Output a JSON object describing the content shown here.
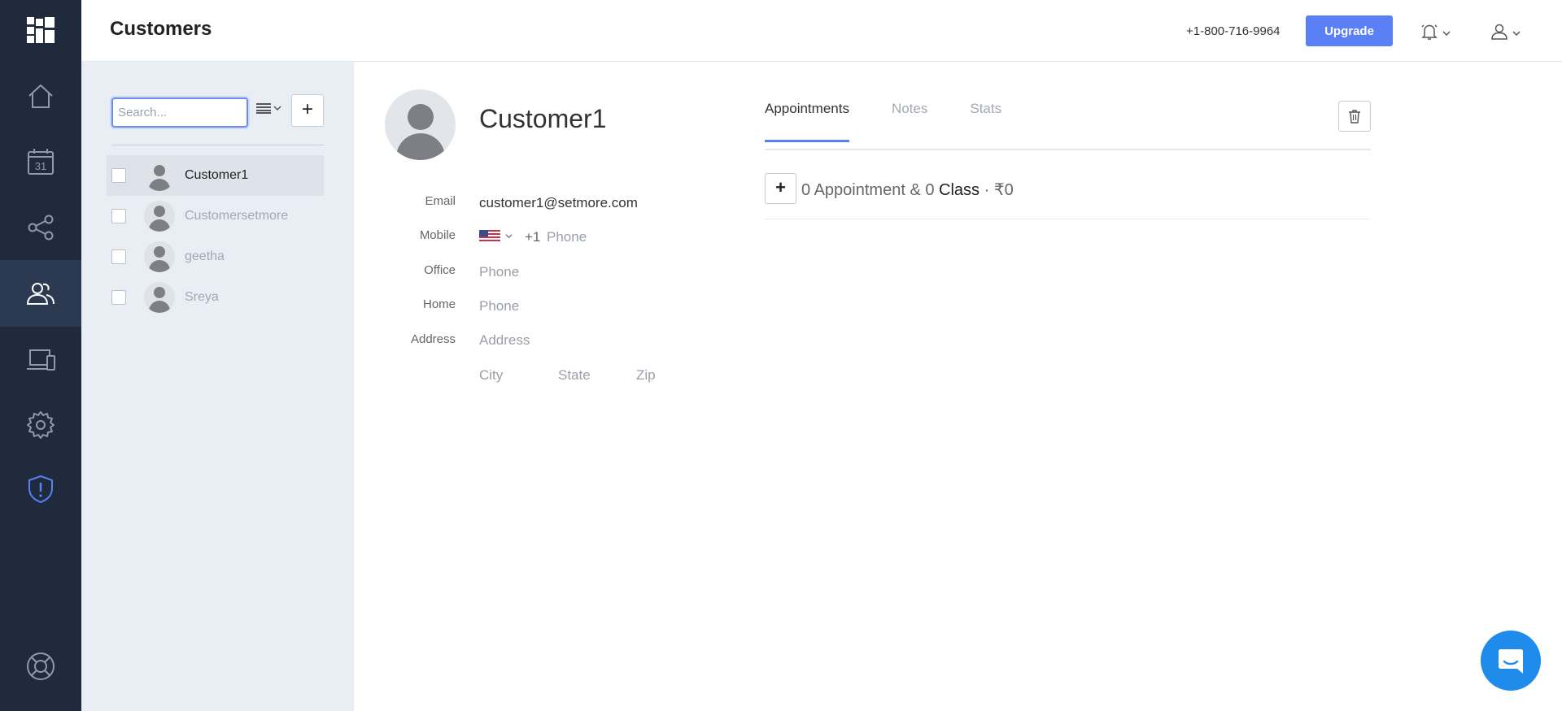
{
  "header": {
    "title": "Customers",
    "phone": "+1-800-716-9964",
    "upgrade_label": "Upgrade"
  },
  "rail": {
    "items": [
      "home-icon",
      "calendar-icon",
      "share-icon",
      "customers-icon",
      "devices-icon",
      "settings-icon",
      "shield-alert-icon",
      "help-icon"
    ],
    "active": "customers-icon",
    "calendar_day": "31"
  },
  "list": {
    "search_placeholder": "Search...",
    "add_label": "+",
    "customers": [
      {
        "name": "Customer1",
        "selected": true
      },
      {
        "name": "Customersetmore",
        "selected": false
      },
      {
        "name": "geetha",
        "selected": false
      },
      {
        "name": "Sreya",
        "selected": false
      }
    ]
  },
  "detail": {
    "name": "Customer1",
    "labels": {
      "email": "Email",
      "mobile": "Mobile",
      "office": "Office",
      "home": "Home",
      "address": "Address"
    },
    "email": "customer1@setmore.com",
    "mobile_code": "+1",
    "mobile_placeholder": "Phone",
    "office_placeholder": "Phone",
    "home_placeholder": "Phone",
    "address_placeholder": "Address",
    "city_placeholder": "City",
    "state_placeholder": "State",
    "zip_placeholder": "Zip"
  },
  "tabs": [
    {
      "label": "Appointments",
      "active": true
    },
    {
      "label": "Notes",
      "active": false
    },
    {
      "label": "Stats",
      "active": false
    }
  ],
  "appointments": {
    "add_label": "+",
    "appt_count": "0",
    "appt_word": "Appointment",
    "amp": "&",
    "class_count": "0",
    "class_word": "Class",
    "dot": "·",
    "amount": "₹0"
  },
  "colors": {
    "rail_bg": "#1f2a3c",
    "accent": "#5b7ff4",
    "panel_bg": "#e9eef4",
    "chat": "#1f8ceb"
  }
}
